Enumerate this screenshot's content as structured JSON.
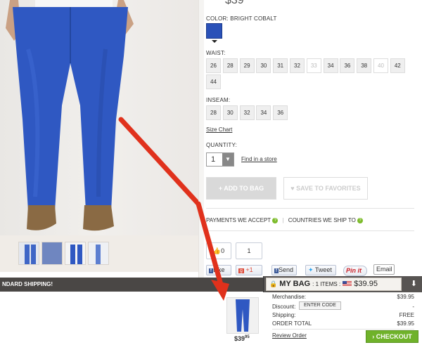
{
  "product": {
    "price_partial": "$39",
    "color_label": "COLOR: BRIGHT COBALT",
    "color_hex": "#2a51b8",
    "waist_label": "WAIST:",
    "waist_sizes": [
      "26",
      "28",
      "29",
      "30",
      "31",
      "32",
      "33",
      "34",
      "36",
      "38",
      "40",
      "42",
      "44"
    ],
    "waist_unavailable": [
      "33",
      "40"
    ],
    "inseam_label": "INSEAM:",
    "inseam_sizes": [
      "28",
      "30",
      "32",
      "34",
      "36"
    ],
    "size_chart": "Size Chart",
    "quantity_label": "QUANTITY:",
    "quantity_value": "1",
    "find_store": "Find in a store",
    "add_to_bag": "+ ADD TO BAG",
    "save_favorites": "SAVE TO FAVORITES",
    "payments": "PAYMENTS WE ACCEPT",
    "countries": "COUNTRIES WE SHIP TO",
    "help_icon_text": "?"
  },
  "social": {
    "like_count": "0",
    "like_label": "Like",
    "gplus_count": "1",
    "gplus_label": "+1",
    "send": "Send",
    "tweet": "Tweet",
    "pin": "Pin it",
    "email": "Email"
  },
  "shipping_banner": "NDARD SHIPPING!",
  "bag": {
    "title": "MY BAG",
    "items": ": 1 ITEMS :",
    "total": "$39.95",
    "rows": {
      "merchandise_label": "Merchandise:",
      "merchandise_value": "$39.95",
      "discount_label": "Discount:",
      "enter_code": "ENTER CODE",
      "discount_value": "-",
      "shipping_label": "Shipping:",
      "shipping_value": "FREE",
      "order_total_label": "ORDER TOTAL",
      "order_total_value": "$39.95"
    },
    "item_price_main": "$39",
    "item_price_cents": "95",
    "review_order": "Review Order",
    "checkout": "CHECKOUT",
    "checkout_icon": "arrow-right"
  },
  "colors": {
    "accent_green": "#6fb22a",
    "annotation_red": "#e0311c",
    "bar_dark": "#4a4745",
    "denim": "#2f58c2"
  }
}
